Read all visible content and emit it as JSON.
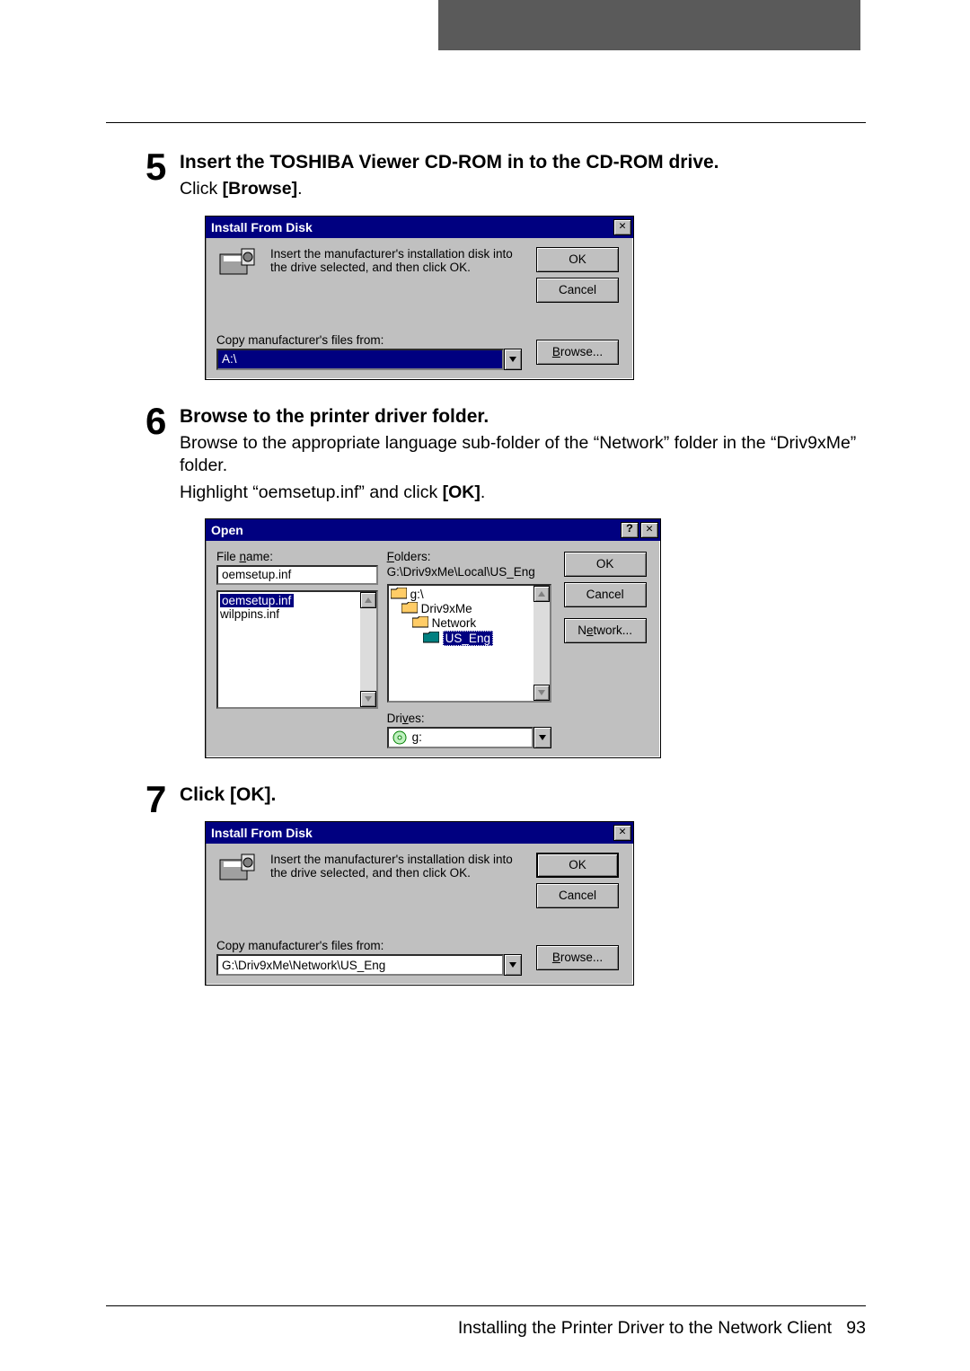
{
  "step5": {
    "num": "5",
    "heading": "Insert the TOSHIBA Viewer CD-ROM in to the CD-ROM drive.",
    "body_pre": "Click ",
    "body_bold": "[Browse]",
    "body_post": "."
  },
  "dlg1": {
    "title": "Install From Disk",
    "msg": "Insert the manufacturer's installation disk into the drive selected, and then click OK.",
    "ok": "OK",
    "cancel": "Cancel",
    "copylabel_pre": "Copy manufacturer's files from:",
    "path": "A:\\",
    "browse_u": "B",
    "browse_rest": "rowse..."
  },
  "step6": {
    "num": "6",
    "heading": "Browse to the printer driver folder.",
    "body1": "Browse to the appropriate language sub-folder of the “Network” folder in the “Driv9xMe” folder.",
    "body2_pre": "Highlight “oemsetup.inf” and click ",
    "body2_bold": "[OK]",
    "body2_post": "."
  },
  "openDlg": {
    "title": "Open",
    "filename_label_u": "n",
    "filename_label_pre": "File ",
    "filename_label_post": "ame:",
    "filename_value": "oemsetup.inf",
    "files": [
      "oemsetup.inf",
      "wilppins.inf"
    ],
    "folders_label_u": "F",
    "folders_label_post": "olders:",
    "folders_path": "G:\\Driv9xMe\\Local\\US_Eng",
    "tree": {
      "root": "g:\\",
      "l1": "Driv9xMe",
      "l2": "Network",
      "l3": "US_Eng"
    },
    "drives_label_pre": "Dri",
    "drives_label_u": "v",
    "drives_label_post": "es:",
    "drive_value": "g:",
    "ok": "OK",
    "cancel": "Cancel",
    "network_pre": "N",
    "network_u": "e",
    "network_post": "twork..."
  },
  "step7": {
    "num": "7",
    "heading": "Click [OK]."
  },
  "dlg2": {
    "title": "Install From Disk",
    "msg": "Insert the manufacturer's installation disk into the drive selected, and then click OK.",
    "ok": "OK",
    "cancel": "Cancel",
    "copylabel": "Copy manufacturer's files from:",
    "path": "G:\\Driv9xMe\\Network\\US_Eng",
    "browse_u": "B",
    "browse_rest": "rowse..."
  },
  "footer": {
    "text": "Installing the Printer Driver to the Network Client",
    "page": "93"
  }
}
